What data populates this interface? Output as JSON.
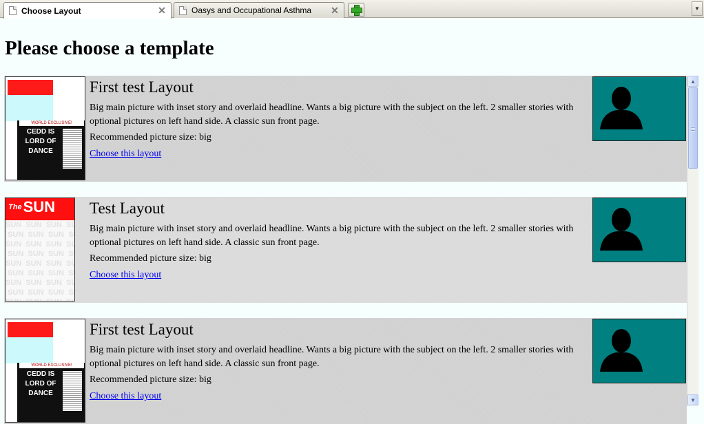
{
  "tabs": [
    {
      "label": "Choose Layout",
      "close": "✕"
    },
    {
      "label": "Oasys and Occupational Asthma",
      "close": "✕"
    }
  ],
  "page_title": "Please choose a template",
  "layouts": [
    {
      "thumbnail_style": "cedd",
      "title": "First test Layout",
      "description": "Big main picture with inset story and overlaid headline. Wants a big picture with the subject on the left. 2 smaller stories with optional pictures on left hand side. A classic sun front page.",
      "picture_size": "Recommended picture size: big",
      "link": "Choose this layout"
    },
    {
      "thumbnail_style": "sun",
      "title": "Test Layout",
      "description": "Big main picture with inset story and overlaid headline. Wants a big picture with the subject on the left. 2 smaller stories with optional pictures on left hand side. A classic sun front page.",
      "picture_size": "Recommended picture size: big",
      "link": "Choose this layout"
    },
    {
      "thumbnail_style": "cedd",
      "title": "First test Layout",
      "description": "Big main picture with inset story and overlaid headline. Wants a big picture with the subject on the left. 2 smaller stories with optional pictures on left hand side. A classic sun front page.",
      "picture_size": "Recommended picture size: big",
      "link": "Choose this layout"
    }
  ],
  "thumbnail_text": {
    "exclusive": "WORLD EXCLUSIVE!",
    "headline": "CEDD IS LORD OF DANCE",
    "sun_logo_the": "The",
    "sun_logo": "SUN"
  },
  "colors": {
    "preview_bg": "#008080",
    "link": "#0000ee",
    "row_bg": "#d0d0d0"
  },
  "icons": {
    "new_tab": "plus-icon",
    "tab_page": "page-icon",
    "preview": "person-silhouette-icon"
  }
}
